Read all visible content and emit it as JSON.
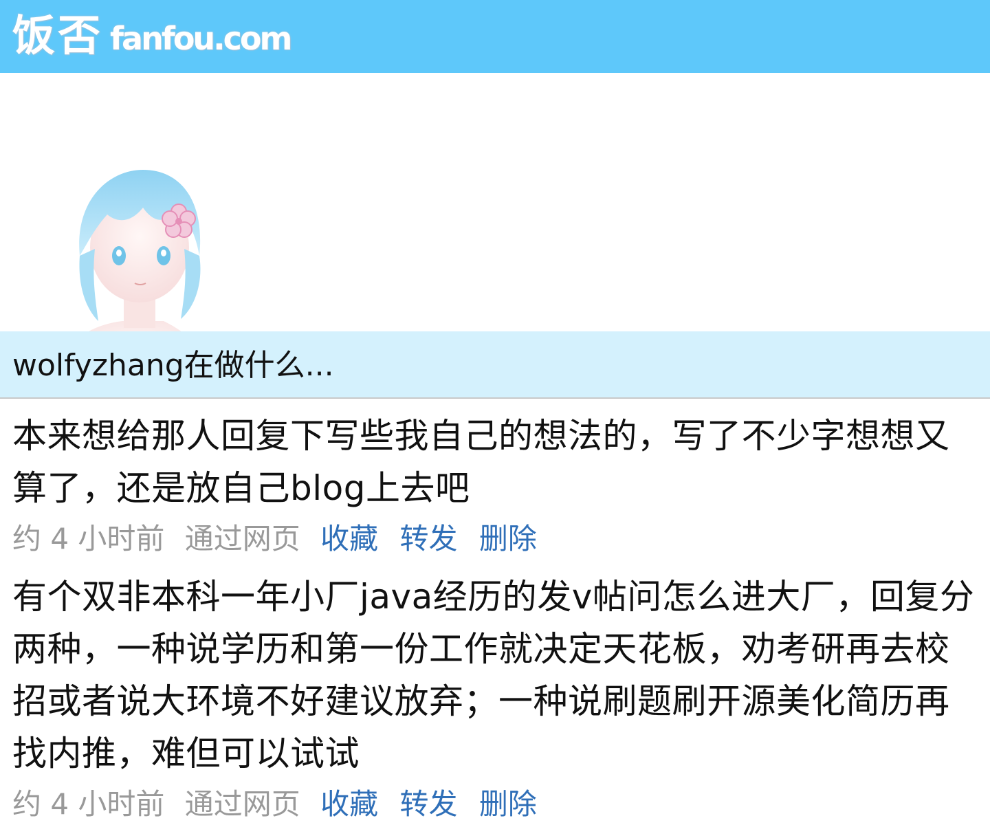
{
  "header": {
    "logo_cn": "饭否",
    "logo_en": "fanfou.com"
  },
  "profile": {
    "avatar_alt": "avatar"
  },
  "what_bar": {
    "title": "wolfyzhang在做什么..."
  },
  "statuses": [
    {
      "text": "本来想给那人回复下写些我自己的想法的，写了不少字想想又算了，还是放自己blog上去吧",
      "time": "约 4 小时前",
      "source": "通过网页",
      "actions": {
        "favorite": "收藏",
        "repost": "转发",
        "delete": "删除"
      }
    },
    {
      "text": "有个双非本科一年小厂java经历的发v帖问怎么进大厂，回复分两种，一种说学历和第一份工作就决定天花板，劝考研再去校招或者说大环境不好建议放弃；一种说刷题刷开源美化简历再找内推，难但可以试试",
      "time": "约 4 小时前",
      "source": "通过网页",
      "actions": {
        "favorite": "收藏",
        "repost": "转发",
        "delete": "删除"
      }
    }
  ],
  "colors": {
    "topbar": "#5ec8fa",
    "whatbar": "#d4f1fd",
    "link": "#2f6fb8",
    "meta": "#999999"
  }
}
